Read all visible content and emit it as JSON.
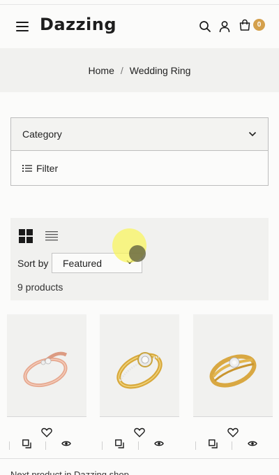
{
  "header": {
    "logo": "Dazzing",
    "cart_count": "0"
  },
  "breadcrumb": {
    "home": "Home",
    "separator": "/",
    "current": "Wedding Ring"
  },
  "filters": {
    "category_label": "Category",
    "filter_label": "Filter"
  },
  "toolbar": {
    "sort_label": "Sort by",
    "sort_value": "Featured",
    "product_count": "9 products",
    "view_modes": [
      "grid-view",
      "list-view"
    ],
    "active_view": "grid-view"
  },
  "products": [
    {
      "ring": "rose-gold-crossover-ring",
      "icons": [
        "heart-icon",
        "compare-icon",
        "eye-icon"
      ]
    },
    {
      "ring": "gold-halo-diamond-ring",
      "icons": [
        "heart-icon",
        "compare-icon",
        "eye-icon"
      ]
    },
    {
      "ring": "gold-twisted-solitaire-ring",
      "icons": [
        "heart-icon",
        "compare-icon",
        "eye-icon"
      ]
    }
  ],
  "footer_snippet": "Next product in Dazzing shop",
  "colors": {
    "accent": "#d4a04c",
    "band": "#f1f1ef",
    "text": "#222222"
  }
}
